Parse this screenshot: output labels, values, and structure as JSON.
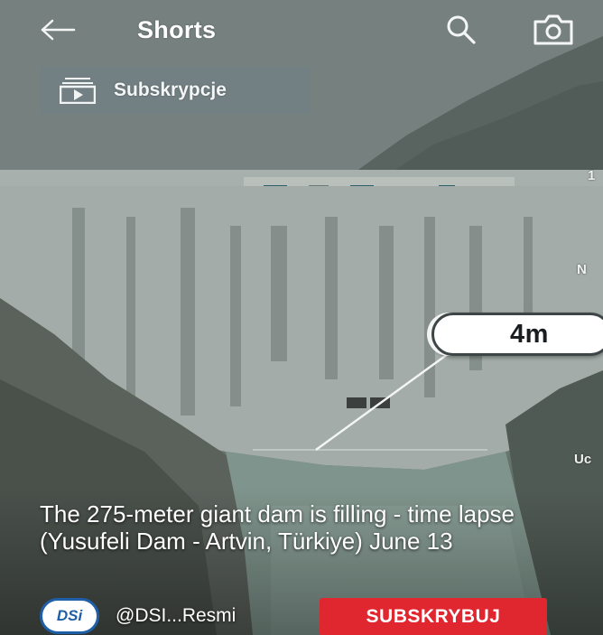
{
  "header": {
    "title": "Shorts",
    "back_icon": "arrow-left-icon",
    "search_icon": "search-icon",
    "camera_icon": "camera-icon"
  },
  "subscriptions_chip": {
    "label": "Subskrypcje",
    "icon": "subscriptions-icon"
  },
  "video": {
    "callout_value": "4m",
    "edge_text": [
      "1",
      "N",
      "Uc"
    ],
    "caption": "The 275-meter giant dam is filling - time lapse (Yusufeli Dam - Artvin, Türkiye) June 13"
  },
  "channel": {
    "avatar_text": "DSi",
    "name": "@DSI...Resmi",
    "subscribe_label": "SUBSKRYBUJ"
  },
  "colors": {
    "subscribe_red": "#e0262f",
    "avatar_blue": "#1f5fa8"
  }
}
